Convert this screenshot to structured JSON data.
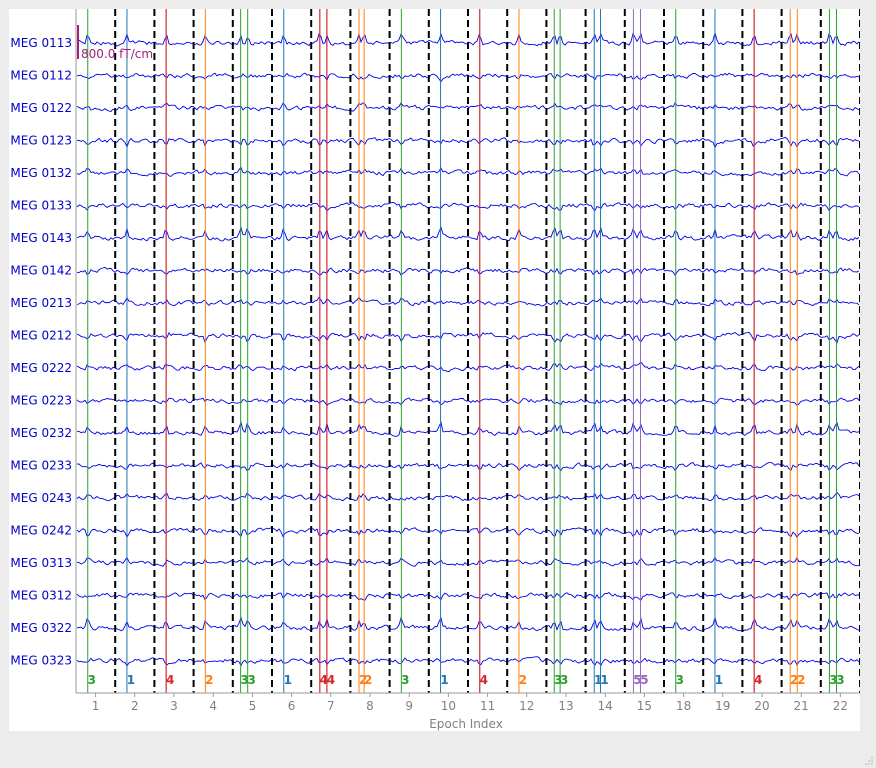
{
  "window": {
    "title": ""
  },
  "chart_data": {
    "type": "line",
    "title": "",
    "xlabel": "Epoch Index",
    "ylabel": "",
    "scale_bar_label": "800.0 fT/cm",
    "channels": [
      "MEG 0113",
      "MEG 0112",
      "MEG 0122",
      "MEG 0123",
      "MEG 0132",
      "MEG 0133",
      "MEG 0143",
      "MEG 0142",
      "MEG 0213",
      "MEG 0212",
      "MEG 0222",
      "MEG 0223",
      "MEG 0232",
      "MEG 0233",
      "MEG 0243",
      "MEG 0242",
      "MEG 0313",
      "MEG 0312",
      "MEG 0322",
      "MEG 0323"
    ],
    "epochs": [
      "1",
      "2",
      "3",
      "4",
      "5",
      "6",
      "7",
      "8",
      "9",
      "10",
      "11",
      "12",
      "13",
      "14",
      "15",
      "18",
      "19",
      "20",
      "21",
      "22"
    ],
    "epoch_boundaries_style": "dashed black",
    "event_colors": {
      "1": "#1f77b4",
      "2": "#ff7f0e",
      "3": "#2ca02c",
      "4": "#d62728",
      "5": "#9467bd"
    },
    "events": [
      {
        "epoch": 1,
        "t": 0.3,
        "id": "3"
      },
      {
        "epoch": 2,
        "t": 0.3,
        "id": "1"
      },
      {
        "epoch": 3,
        "t": 0.3,
        "id": "4"
      },
      {
        "epoch": 4,
        "t": 0.3,
        "id": "2"
      },
      {
        "epoch": 5,
        "t": 0.2,
        "id": "3"
      },
      {
        "epoch": 5,
        "t": 0.38,
        "id": "3"
      },
      {
        "epoch": 6,
        "t": 0.3,
        "id": "1"
      },
      {
        "epoch": 7,
        "t": 0.22,
        "id": "4"
      },
      {
        "epoch": 7,
        "t": 0.4,
        "id": "4"
      },
      {
        "epoch": 8,
        "t": 0.22,
        "id": "2"
      },
      {
        "epoch": 8,
        "t": 0.35,
        "id": "2"
      },
      {
        "epoch": 9,
        "t": 0.3,
        "id": "3"
      },
      {
        "epoch": 10,
        "t": 0.3,
        "id": "1"
      },
      {
        "epoch": 11,
        "t": 0.3,
        "id": "4"
      },
      {
        "epoch": 12,
        "t": 0.3,
        "id": "2"
      },
      {
        "epoch": 13,
        "t": 0.2,
        "id": "3"
      },
      {
        "epoch": 13,
        "t": 0.35,
        "id": "3"
      },
      {
        "epoch": 14,
        "t": 0.22,
        "id": "1"
      },
      {
        "epoch": 14,
        "t": 0.38,
        "id": "1"
      },
      {
        "epoch": 15,
        "t": 0.22,
        "id": "5"
      },
      {
        "epoch": 15,
        "t": 0.4,
        "id": "5"
      },
      {
        "epoch": 16,
        "t": 0.3,
        "id": "3"
      },
      {
        "epoch": 17,
        "t": 0.3,
        "id": "1"
      },
      {
        "epoch": 18,
        "t": 0.3,
        "id": "4"
      },
      {
        "epoch": 19,
        "t": 0.22,
        "id": "2"
      },
      {
        "epoch": 19,
        "t": 0.4,
        "id": "2"
      },
      {
        "epoch": 20,
        "t": 0.22,
        "id": "3"
      },
      {
        "epoch": 20,
        "t": 0.4,
        "id": "3"
      }
    ],
    "grid": false,
    "legend": "none"
  }
}
